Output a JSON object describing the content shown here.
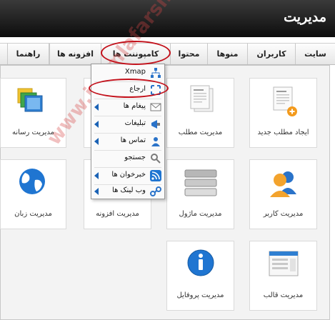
{
  "header": {
    "title": "مدیریت"
  },
  "menu": {
    "items": [
      {
        "id": "site",
        "label": "سایت"
      },
      {
        "id": "users",
        "label": "کاربران"
      },
      {
        "id": "menus",
        "label": "منوها"
      },
      {
        "id": "content",
        "label": "محتوا"
      },
      {
        "id": "components",
        "label": "کامپوننت ها"
      },
      {
        "id": "extensions",
        "label": "افزونه ها"
      },
      {
        "id": "help",
        "label": "راهنما"
      }
    ]
  },
  "components_dropdown": {
    "items": [
      {
        "label": "Xmap",
        "icon": "sitemap-icon",
        "has_submenu": false
      },
      {
        "label": "ارجاع",
        "icon": "redirect-icon",
        "has_submenu": false
      },
      {
        "label": "پیغام ها",
        "icon": "messages-icon",
        "has_submenu": true
      },
      {
        "label": "تبلیغات",
        "icon": "banners-icon",
        "has_submenu": true
      },
      {
        "label": "تماس ها",
        "icon": "contacts-icon",
        "has_submenu": true
      },
      {
        "label": "جستجو",
        "icon": "search-icon",
        "has_submenu": false
      },
      {
        "label": "خبرخوان ها",
        "icon": "rss-icon",
        "has_submenu": true
      },
      {
        "label": "وب لینک ها",
        "icon": "weblinks-icon",
        "has_submenu": true
      }
    ]
  },
  "quick_icons": [
    {
      "label": "ایجاد مطلب جدید",
      "icon": "add-article-icon"
    },
    {
      "label": "مدیریت مطلب",
      "icon": "article-manager-icon"
    },
    {
      "label": "",
      "icon": "category-manager-icon"
    },
    {
      "label": "مدیریت رسانه",
      "icon": "media-manager-icon"
    },
    {
      "label": "مدیریت کاربر",
      "icon": "user-manager-icon"
    },
    {
      "label": "مدیریت ماژول",
      "icon": "module-manager-icon"
    },
    {
      "label": "مدیریت افزونه",
      "icon": "extension-manager-icon"
    },
    {
      "label": "مدیریت زبان",
      "icon": "language-manager-icon"
    },
    {
      "label": "مدیریت قالب",
      "icon": "template-manager-icon"
    },
    {
      "label": "مدیریت پروفایل",
      "icon": "profile-icon"
    }
  ],
  "watermark": "www.joomlafarsi.com",
  "colors": {
    "header_bg": "#1a1a1a",
    "highlight_ellipse": "#c3111b",
    "watermark": "#d64646",
    "accent_blue": "#1a62b5"
  }
}
